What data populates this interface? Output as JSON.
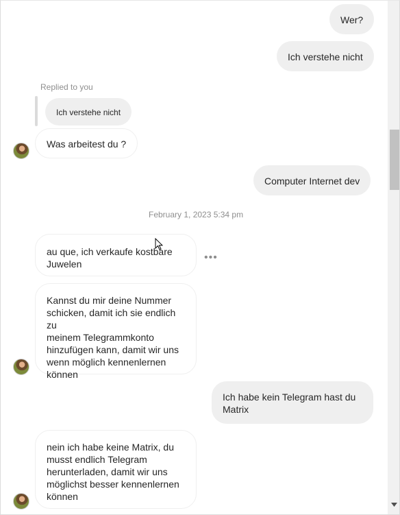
{
  "messages": {
    "m1": "Wer?",
    "m2": "Ich verstehe nicht",
    "replied_label": "Replied to you",
    "quoted": "Ich verstehe nicht",
    "m3": "Was arbeitest du ?",
    "m4": "Computer Internet dev",
    "timestamp": "February 1, 2023 5:34 pm",
    "m5": "au que, ich verkaufe kostbare\nJuwelen",
    "m6": "Kannst du mir deine Nummer\nschicken, damit ich sie endlich zu\nmeinem Telegrammkonto\nhinzufügen kann, damit wir uns\nwenn möglich kennenlernen\nkönnen",
    "m7": "Ich habe kein Telegram hast du\nMatrix",
    "m8": "nein ich habe keine Matrix, du\nmusst endlich Telegram\nherunterladen, damit wir uns\nmöglichst besser kennenlernen\nkönnen"
  },
  "icons": {
    "more": "more-options-icon",
    "scroll_down": "chevron-down-icon"
  },
  "colors": {
    "outgoing_bubble": "#efefef",
    "incoming_border": "#efefef",
    "muted_text": "#8e8e8e"
  }
}
